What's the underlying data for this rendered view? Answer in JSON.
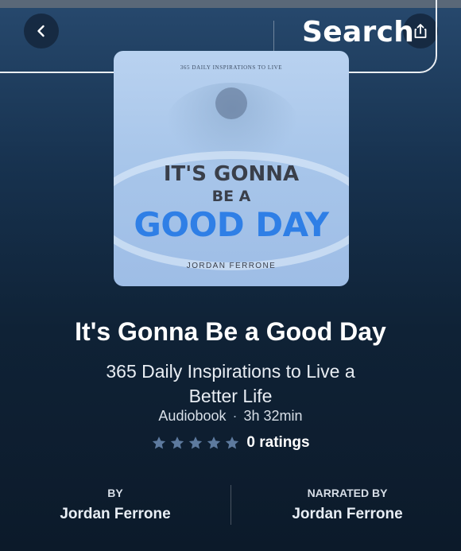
{
  "header": {
    "back_icon": "chevron-left-icon",
    "share_icon": "share-icon",
    "search_label": "Search"
  },
  "cover": {
    "tagline": "365 DAILY INSPIRATIONS TO LIVE",
    "line1": "IT'S GONNA",
    "line2": "BE A",
    "line3": "GOOD DAY",
    "author": "JORDAN FERRONE",
    "accent_color": "#2f7fe6"
  },
  "book": {
    "title": "It's Gonna Be a Good Day",
    "subtitle": "365 Daily Inspirations to Live a Better Life",
    "format": "Audiobook",
    "separator": "·",
    "duration": "3h 32min",
    "stars_filled": 0,
    "stars_total": 5,
    "ratings_text": "0 ratings"
  },
  "credits": {
    "by_label": "BY",
    "by_name": "Jordan Ferrone",
    "narrated_label": "NARRATED BY",
    "narrated_name": "Jordan Ferrone"
  }
}
